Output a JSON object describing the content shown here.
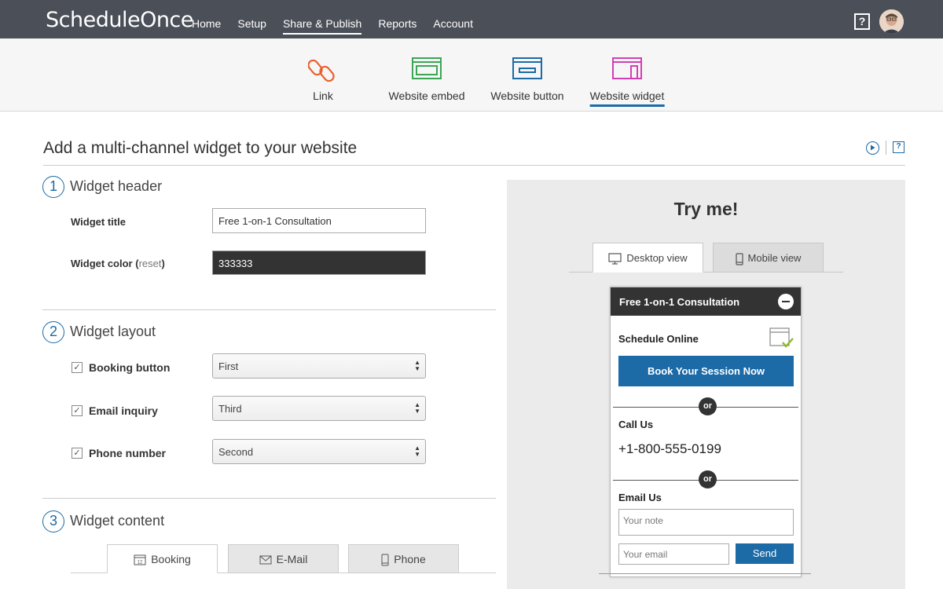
{
  "header": {
    "logo": "ScheduleOnce",
    "nav": [
      "Home",
      "Setup",
      "Share & Publish",
      "Reports",
      "Account"
    ],
    "active_nav": "Share & Publish",
    "help": "?"
  },
  "share_options": [
    {
      "label": "Link",
      "icon": "link-icon",
      "color": "#e8602c"
    },
    {
      "label": "Website embed",
      "icon": "embed-icon",
      "color": "#3aa655"
    },
    {
      "label": "Website button",
      "icon": "button-icon",
      "color": "#1c6aa6"
    },
    {
      "label": "Website widget",
      "icon": "widget-icon",
      "color": "#d23fb4"
    }
  ],
  "active_share": "Website widget",
  "page": {
    "title": "Add a multi-channel widget to your website",
    "help": "?"
  },
  "sections": {
    "header": {
      "number": "1",
      "title": "Widget header"
    },
    "layout": {
      "number": "2",
      "title": "Widget layout"
    },
    "content": {
      "number": "3",
      "title": "Widget content"
    }
  },
  "fields": {
    "widget_title_label": "Widget title",
    "widget_title_value": "Free 1-on-1 Consultation",
    "widget_color_label": "Widget color",
    "widget_color_reset": "reset",
    "widget_color_value": "333333"
  },
  "layout_rows": [
    {
      "label": "Booking button",
      "checked": true,
      "value": "First"
    },
    {
      "label": "Email inquiry",
      "checked": true,
      "value": "Third"
    },
    {
      "label": "Phone number",
      "checked": true,
      "value": "Second"
    }
  ],
  "content_tabs": [
    "Booking",
    "E-Mail",
    "Phone"
  ],
  "booking_tab_icon_text": "12",
  "preview": {
    "title": "Try me!",
    "tabs": [
      "Desktop view",
      "Mobile view"
    ],
    "widget": {
      "header": "Free 1-on-1 Consultation",
      "schedule_label": "Schedule Online",
      "book_button": "Book Your Session Now",
      "or": "or",
      "call_label": "Call Us",
      "phone": "+1-800-555-0199",
      "email_label": "Email Us",
      "note_placeholder": "Your note",
      "email_placeholder": "Your email",
      "send": "Send"
    }
  },
  "colors": {
    "accent": "#1c6aa6",
    "topbar": "#4a4f58",
    "widget_header": "#333333"
  }
}
